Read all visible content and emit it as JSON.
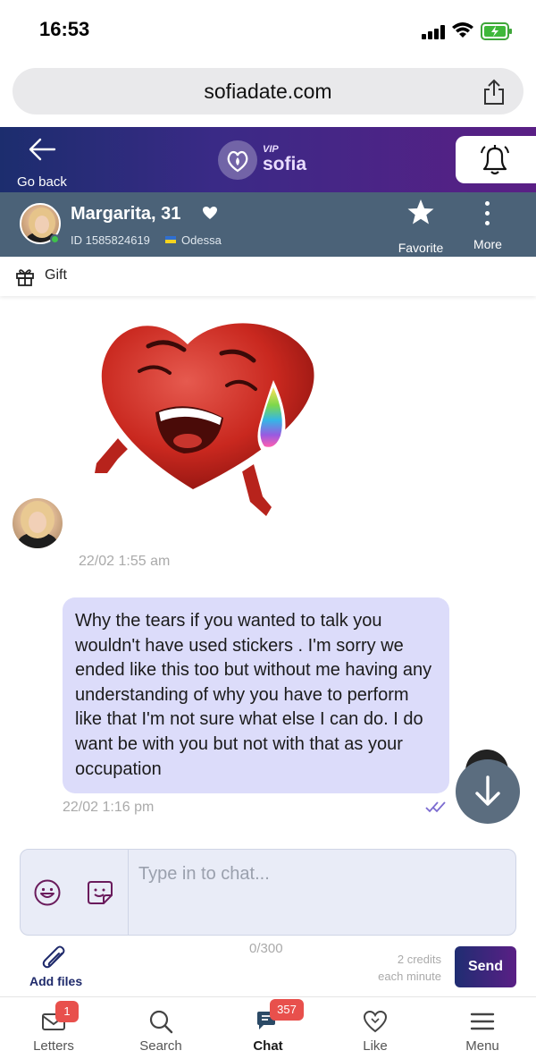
{
  "status_bar": {
    "time": "16:53"
  },
  "browser": {
    "url": "sofiadate.com"
  },
  "header": {
    "back_label": "Go back",
    "logo_vip": "VIP",
    "logo_name": "sofia"
  },
  "profile": {
    "name": "Margarita, 31",
    "id_text": "ID 1585824619",
    "city": "Odessa",
    "favorite_label": "Favorite",
    "more_label": "More"
  },
  "gift": {
    "label": "Gift"
  },
  "messages": [
    {
      "type": "sticker",
      "direction": "incoming",
      "timestamp": "22/02 1:55 am"
    },
    {
      "type": "text",
      "direction": "outgoing",
      "text": "Why the tears if you wanted to talk you wouldn't have used stickers . I'm sorry we ended like this too but without me having any understanding of why you have to perform like that I'm not sure what else I can do. I do want be with you but not with that as your occupation",
      "timestamp": "22/02 1:16 pm",
      "status": "read"
    }
  ],
  "composer": {
    "placeholder": "Type in to chat...",
    "counter": "0/300",
    "add_files_label": "Add files",
    "credits_line1": "2 credits",
    "credits_line2": "each minute",
    "send_label": "Send"
  },
  "bottom_nav": [
    {
      "label": "Letters",
      "icon": "envelope-icon",
      "badge": "1",
      "active": false
    },
    {
      "label": "Search",
      "icon": "search-icon",
      "badge": "",
      "active": false
    },
    {
      "label": "Chat",
      "icon": "chat-icon",
      "badge": "357",
      "active": true
    },
    {
      "label": "Like",
      "icon": "heart-icon",
      "badge": "",
      "active": false
    },
    {
      "label": "Menu",
      "icon": "hamburger-icon",
      "badge": "",
      "active": false
    }
  ],
  "colors": {
    "header_gradient_start": "#1c2d6e",
    "header_gradient_end": "#5a1f85",
    "profile_bar": "#4b6278",
    "outgoing_bubble": "#dcdcfa",
    "badge": "#e8504c"
  }
}
